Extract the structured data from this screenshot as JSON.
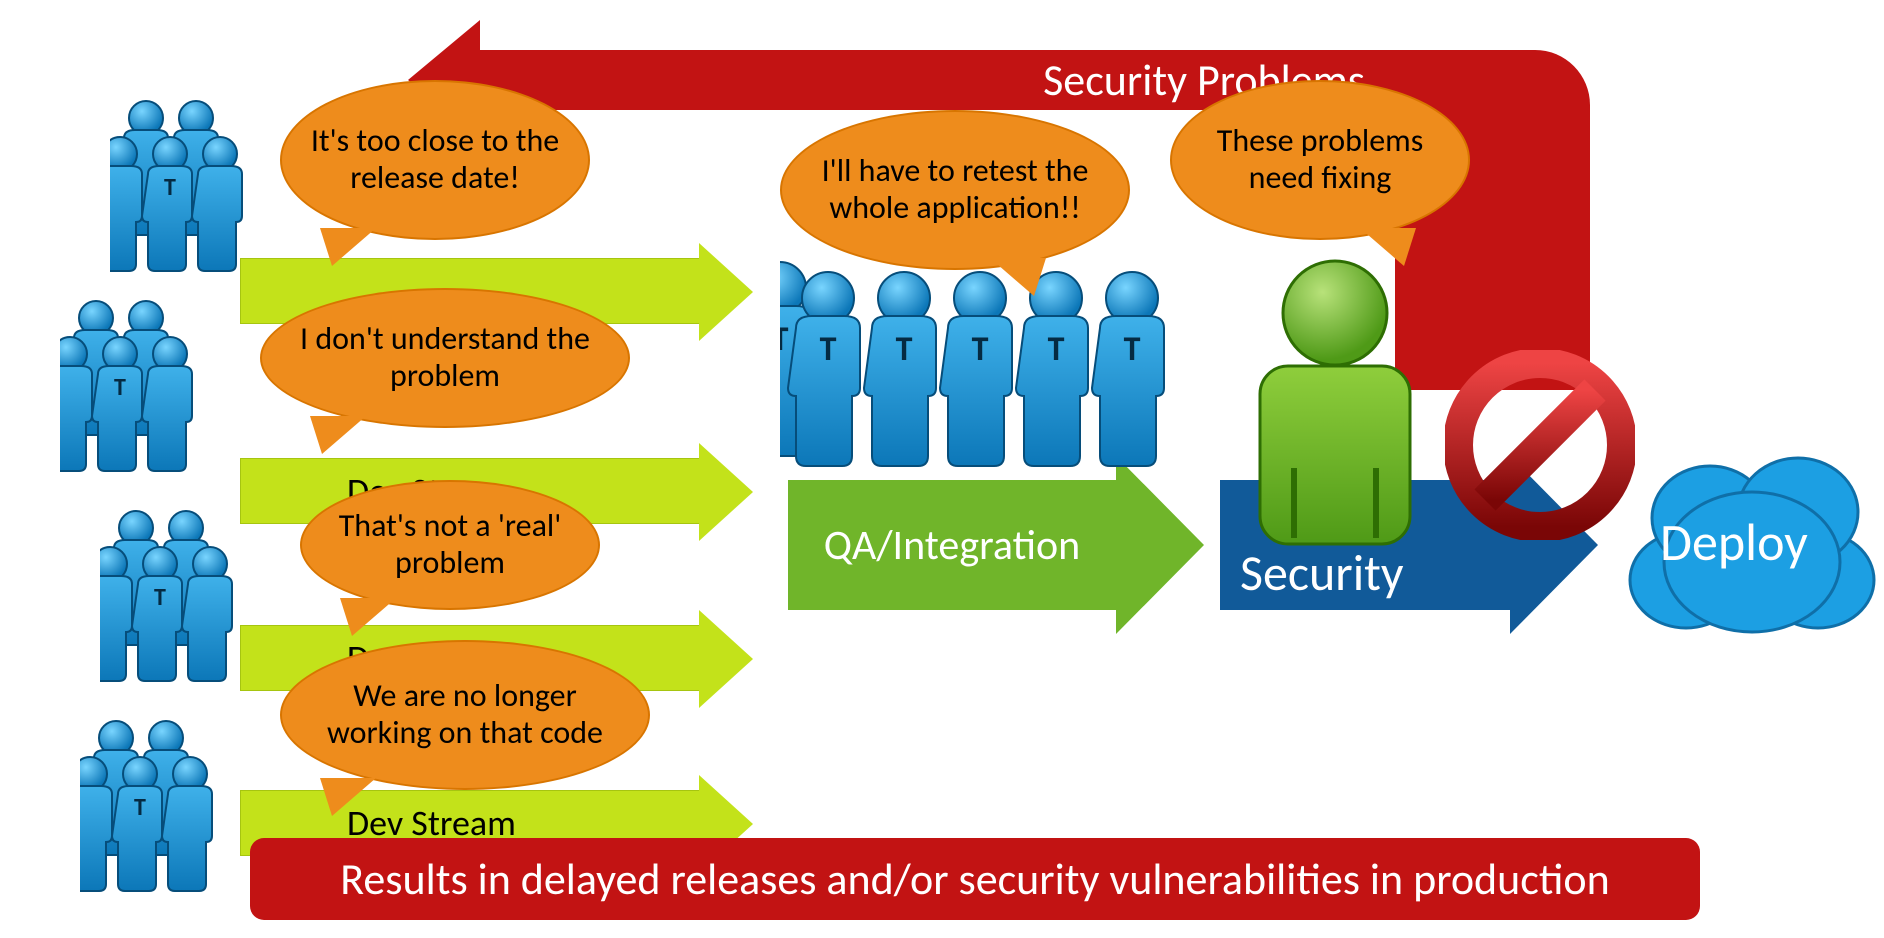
{
  "feedback": {
    "title": "Security Problems"
  },
  "dev_streams": {
    "labels": [
      "Dev Stream",
      "Dev Stream",
      "Dev Stream"
    ]
  },
  "qa": {
    "label": "QA/Integration"
  },
  "security": {
    "label": "Security"
  },
  "deploy": {
    "label": "Deploy"
  },
  "bubbles": {
    "too_close": "It's too close to the release date!",
    "dont_understand": "I don't understand the problem",
    "not_real": "That's not a 'real' problem",
    "no_longer": "We are no longer working on that code",
    "retest": "I'll have to retest the whole application!!",
    "need_fixing": "These problems need fixing"
  },
  "result": {
    "text": "Results in delayed releases and/or security vulnerabilities in production"
  },
  "colors": {
    "red": "#c21313",
    "orange": "#ee8c1c",
    "yellowgreen": "#c3e21a",
    "green": "#70b52a",
    "blue_dark": "#115a99",
    "blue": "#1c9fe3",
    "person_green": "#6fb82b"
  }
}
